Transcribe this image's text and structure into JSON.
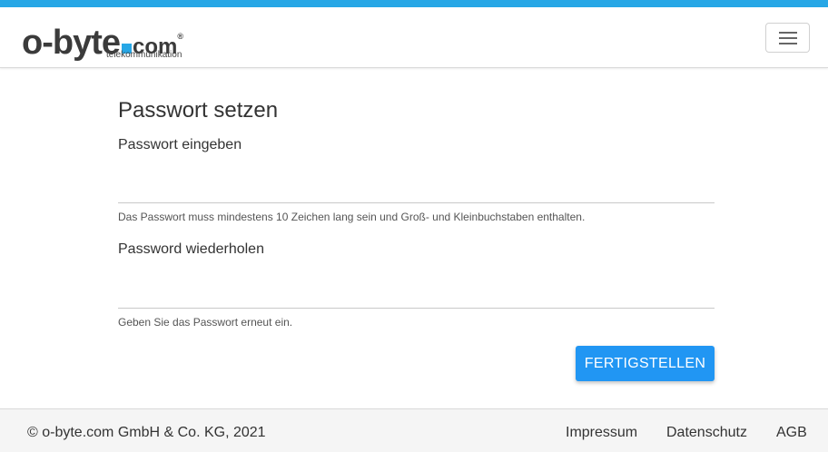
{
  "brand": {
    "name_main": "o-byte",
    "name_tld": "com",
    "registered": "®",
    "subtitle": "telekommunikation",
    "accent_color": "#27a7e6"
  },
  "header": {
    "menu_icon": "hamburger-icon"
  },
  "form": {
    "title": "Passwort setzen",
    "password": {
      "label": "Passwort eingeben",
      "value": "",
      "hint": "Das Passwort muss mindestens 10 Zeichen lang sein und Groß- und Kleinbuchstaben enthalten."
    },
    "password_repeat": {
      "label": "Password wiederholen",
      "value": "",
      "hint": "Geben Sie das Passwort erneut ein."
    },
    "submit_label": "FERTIGSTELLEN",
    "submit_color": "#2196f3"
  },
  "footer": {
    "copyright": "© o-byte.com GmbH & Co. KG, 2021",
    "links": [
      "Impressum",
      "Datenschutz",
      "AGB"
    ]
  }
}
